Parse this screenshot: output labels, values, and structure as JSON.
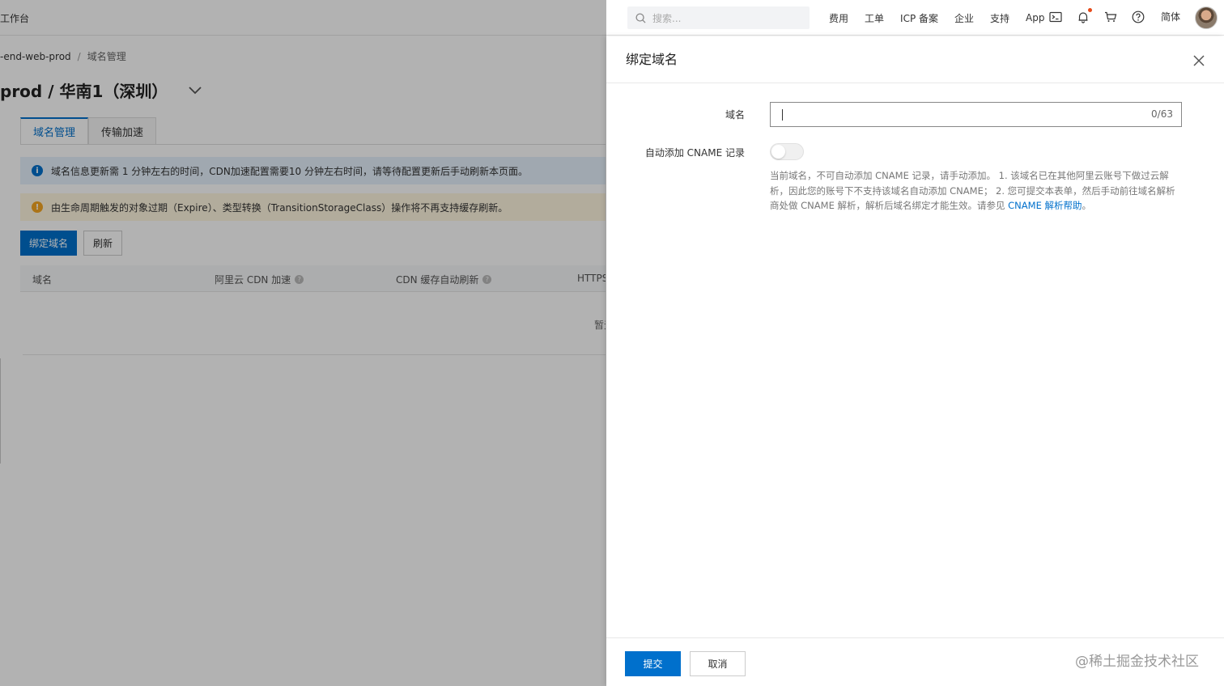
{
  "topbar": {
    "brand": "工作台",
    "search_placeholder": "搜索...",
    "nav": [
      "费用",
      "工单",
      "ICP 备案",
      "企业",
      "支持",
      "App"
    ],
    "icons": [
      "terminal-icon",
      "bell-icon",
      "cart-icon",
      "help-icon"
    ],
    "lang": "简体"
  },
  "page": {
    "breadcrumb": {
      "bucket": "-end-web-prod",
      "separator": "/",
      "current": "域名管理"
    },
    "title": "prod / 华南1（深圳）",
    "tabs": [
      {
        "label": "域名管理",
        "active": true
      },
      {
        "label": "传输加速",
        "active": false
      }
    ],
    "alert_info": "域名信息更新需 1 分钟左右的时间，CDN加速配置需要10 分钟左右时间，请等待配置更新后手动刷新本页面。",
    "alert_warn": "由生命周期触发的对象过期（Expire）、类型转换（TransitionStorageClass）操作将不再支持缓存刷新。",
    "bind_button": "绑定域名",
    "refresh_button": "刷新",
    "table_headers": [
      "域名",
      "阿里云 CDN 加速",
      "CDN 缓存自动刷新",
      "HTTPS"
    ],
    "empty_text": "暂无数据"
  },
  "drawer": {
    "title": "绑定域名",
    "domain_label": "域名",
    "domain_value": "",
    "domain_count": "0/63",
    "cname_label": "自动添加 CNAME 记录",
    "cname_enabled": false,
    "help_text": "当前域名，不可自动添加 CNAME 记录，请手动添加。 1. 该域名已在其他阿里云账号下做过云解析，因此您的账号下不支持该域名自动添加 CNAME； 2. 您可提交本表单，然后手动前往域名解析商处做 CNAME 解析，解析后域名绑定才能生效。请参见 ",
    "help_link": "CNAME 解析帮助",
    "help_end": "。",
    "submit": "提交",
    "cancel": "取消"
  },
  "watermark": "@稀土掘金技术社区",
  "colors": {
    "primary": "#0070cc",
    "info_bg": "#e6f1fc",
    "warn_bg": "#fff6e0",
    "warn_icon": "#f5a623"
  }
}
